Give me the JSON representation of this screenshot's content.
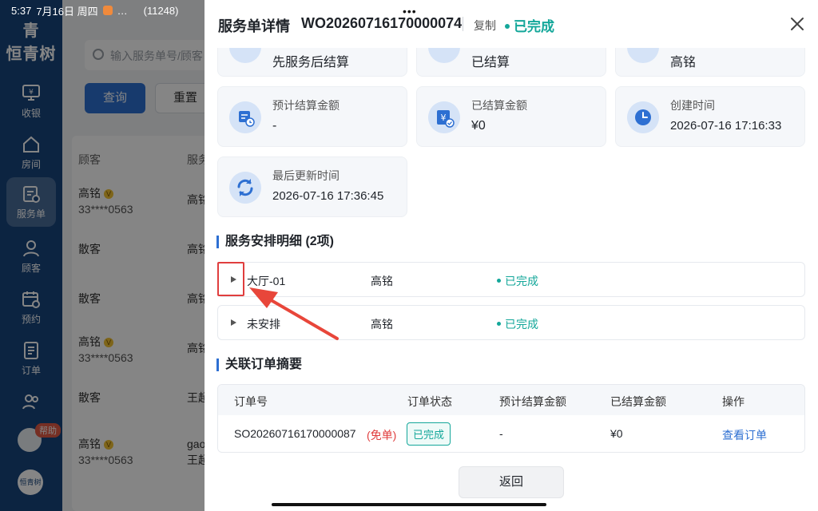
{
  "status_bar": {
    "time": "5:37",
    "date": "7月16日 周四",
    "extra": "…",
    "count": "(11248)"
  },
  "sidebar": {
    "logo_mark": "青",
    "logo_text": "恒青树",
    "items": [
      {
        "label": "收银",
        "icon": "cashier-icon"
      },
      {
        "label": "房间",
        "icon": "home-icon"
      },
      {
        "label": "服务单",
        "icon": "service-order-icon"
      },
      {
        "label": "顾客",
        "icon": "user-icon"
      },
      {
        "label": "预约",
        "icon": "calendar-icon"
      },
      {
        "label": "订单",
        "icon": "order-icon"
      },
      {
        "label": "",
        "icon": "users-icon"
      }
    ],
    "help_badge": "帮助",
    "bottom_logo": "恒青树"
  },
  "background": {
    "search_placeholder": "输入服务单号/顾客",
    "query_button": "查询",
    "reset_button": "重置",
    "col_customer": "顾客",
    "col_staff": "服务",
    "rows": [
      {
        "name": "高铭",
        "vip": true,
        "phone": "33****0563",
        "staff": "高铭"
      },
      {
        "name": "散客",
        "vip": false,
        "phone": "",
        "staff": "高铭"
      },
      {
        "name": "散客",
        "vip": false,
        "phone": "",
        "staff": "高铭"
      },
      {
        "name": "高铭",
        "vip": true,
        "phone": "33****0563",
        "staff": "高铭"
      },
      {
        "name": "散客",
        "vip": false,
        "phone": "",
        "staff": "王超"
      },
      {
        "name": "高铭",
        "vip": true,
        "phone": "33****0563",
        "staff": "gao",
        "staff2": "王超"
      }
    ],
    "vip_mark": "V"
  },
  "drawer": {
    "title": "服务单详情",
    "order_no": "WO20260716170000074",
    "copy_label": "复制",
    "status": "已完成",
    "close_icon": "close-icon",
    "cards_top": [
      {
        "value": "先服务后结算",
        "icon": "settle-mode-icon"
      },
      {
        "value": "已结算",
        "icon": "settled-icon"
      },
      {
        "value": "高铭",
        "icon": "staff-icon"
      }
    ],
    "cards": [
      {
        "label": "预计结算金额",
        "value": "-",
        "icon": "estimate-calendar-icon"
      },
      {
        "label": "已结算金额",
        "value": "¥0",
        "icon": "yen-icon"
      },
      {
        "label": "创建时间",
        "value": "2026-07-16 17:16:33",
        "icon": "clock-icon"
      },
      {
        "label": "最后更新时间",
        "value": "2026-07-16 17:36:45",
        "icon": "refresh-icon"
      }
    ],
    "service_section_title": "服务安排明细 (2项)",
    "services": [
      {
        "name": "大厅-01",
        "staff": "高铭",
        "status": "已完成"
      },
      {
        "name": "未安排",
        "staff": "高铭",
        "status": "已完成"
      }
    ],
    "order_section_title": "关联订单摘要",
    "order_table": {
      "headers": [
        "订单号",
        "订单状态",
        "预计结算金额",
        "已结算金额",
        "操作"
      ],
      "row": {
        "order_no": "SO20260716170000087",
        "free_tag": "(免单)",
        "status": "已完成",
        "estimate": "-",
        "settled": "¥0",
        "action": "查看订单"
      }
    },
    "back_button": "返回"
  },
  "colors": {
    "accent": "#2d6fd2",
    "success": "#14a79a",
    "highlight": "#e03e3e",
    "sidebar": "#17457e"
  }
}
